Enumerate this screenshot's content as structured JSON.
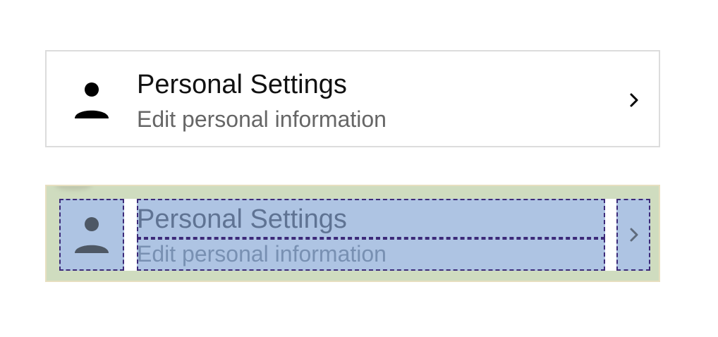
{
  "rows": [
    {
      "title": "Personal Settings",
      "subtitle": "Edit personal information",
      "icon": "person-icon",
      "trailing_icon": "chevron-right-icon"
    },
    {
      "title": "Personal Settings",
      "subtitle": "Edit personal information",
      "icon": "person-icon",
      "trailing_icon": "chevron-right-icon"
    }
  ],
  "colors": {
    "title": "#111111",
    "subtitle": "#666666",
    "row_border": "#dcdcdc",
    "inspector_background": "#cfdcbf",
    "inspector_frame": "#aec4e3",
    "inspector_dashed_border": "#3c2a79"
  }
}
